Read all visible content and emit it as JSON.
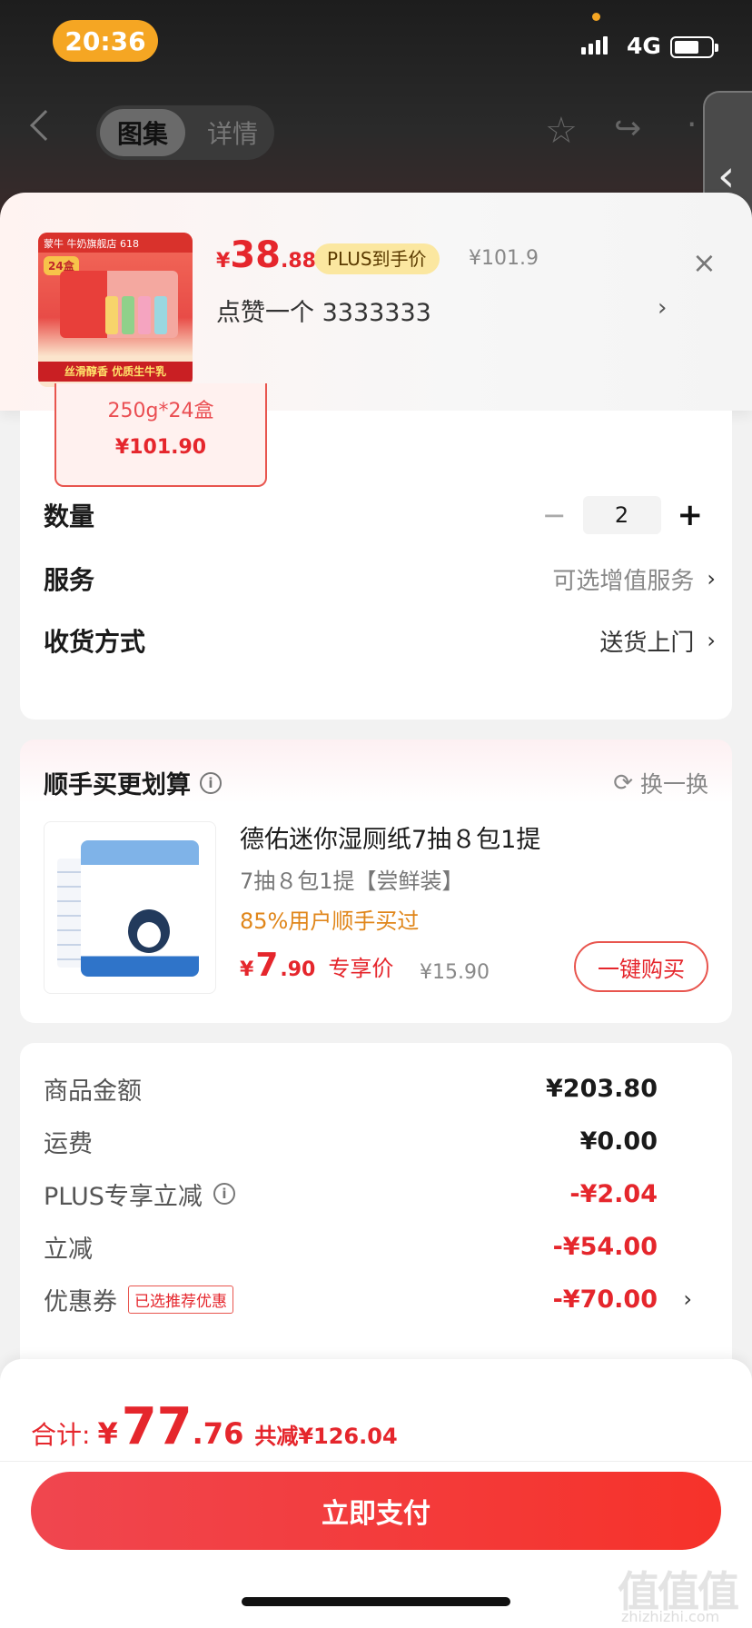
{
  "status_bar": {
    "time": "20:36",
    "network": "4G"
  },
  "nav": {
    "tab_gallery": "图集",
    "tab_detail": "详情"
  },
  "popover": {
    "currency": "¥",
    "price_int": "38",
    "price_dec": ".88",
    "plus_badge": "PLUS到手价",
    "original_price": "¥101.9",
    "subtitle": "点赞一个  3333333",
    "thumb_store": "蒙牛 牛奶旗舰店 618",
    "thumb_count": "24盒",
    "thumb_slogan": "丝滑醇香 优质生牛乳"
  },
  "spec": {
    "text": "250g*24盒",
    "price": "¥101.90"
  },
  "options": {
    "quantity_label": "数量",
    "quantity_value": "2",
    "service_label": "服务",
    "service_value": "可选增值服务",
    "delivery_label": "收货方式",
    "delivery_value": "送货上门"
  },
  "recommend": {
    "title": "顺手买更划算",
    "swap": "换一换",
    "name": "德佑迷你湿厕纸7抽８包1提",
    "subtitle": "7抽８包1提【尝鲜装】",
    "hint": "85%用户顺手买过",
    "currency": "¥",
    "price_int": "7",
    "price_dec": ".90",
    "price_tag": "专享价",
    "original_price": "¥15.90",
    "buy_button": "一键购买"
  },
  "pricing": {
    "goods_label": "商品金额",
    "goods_value": "¥203.80",
    "shipping_label": "运费",
    "shipping_value": "¥0.00",
    "plus_label": "PLUS专享立减",
    "plus_value": "-¥2.04",
    "discount_label": "立减",
    "discount_value": "-¥54.00",
    "coupon_label": "优惠券",
    "coupon_tag": "已选推荐优惠",
    "coupon_value": "-¥70.00"
  },
  "footer": {
    "total_label": "合计:",
    "currency": "¥",
    "total_int": "77",
    "total_dec": ".76",
    "saved": "共减¥126.04",
    "pay_button": "立即支付",
    "watermark": "值值值",
    "watermark_url": "zhizhizhi.com"
  },
  "colors": {
    "accent_red": "#e5262c",
    "plus_gold": "#fbe7a0",
    "hint_orange": "#e0861a"
  }
}
